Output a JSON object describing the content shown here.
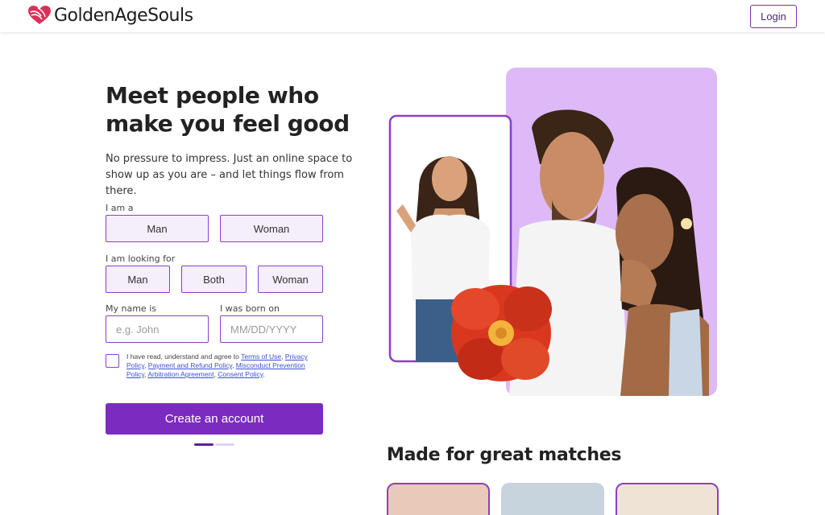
{
  "header": {
    "brand": "GoldenAgeSouls",
    "logo_icon": "heart-logo-icon",
    "login_label": "Login"
  },
  "hero": {
    "headline_line1": "Meet people who",
    "headline_line2": "make you feel good",
    "subtext": "No pressure to impress. Just an online space to show up as you are – and let things flow from there."
  },
  "form": {
    "i_am_label": "I am a",
    "i_am_options": [
      "Man",
      "Woman"
    ],
    "looking_for_label": "I am looking for",
    "looking_for_options": [
      "Man",
      "Both",
      "Woman"
    ],
    "name_label": "My name is",
    "name_placeholder": "e.g. John",
    "born_label": "I was born on",
    "born_placeholder": "MM/DD/YYYY",
    "consent_prefix": "I have read, understand and agree to ",
    "consent_links": [
      "Terms of Use",
      "Privacy Policy",
      "Payment and Refund Policy",
      "Misconduct Prevention Policy",
      "Arbitration Agreement",
      "Consent Policy"
    ],
    "create_label": "Create an account"
  },
  "matches": {
    "title": "Made for great matches"
  },
  "colors": {
    "brand": "#7b2bc0",
    "lilac": "#deb9f7",
    "option_bg": "#f5eefb",
    "link": "#3b4fd6"
  }
}
